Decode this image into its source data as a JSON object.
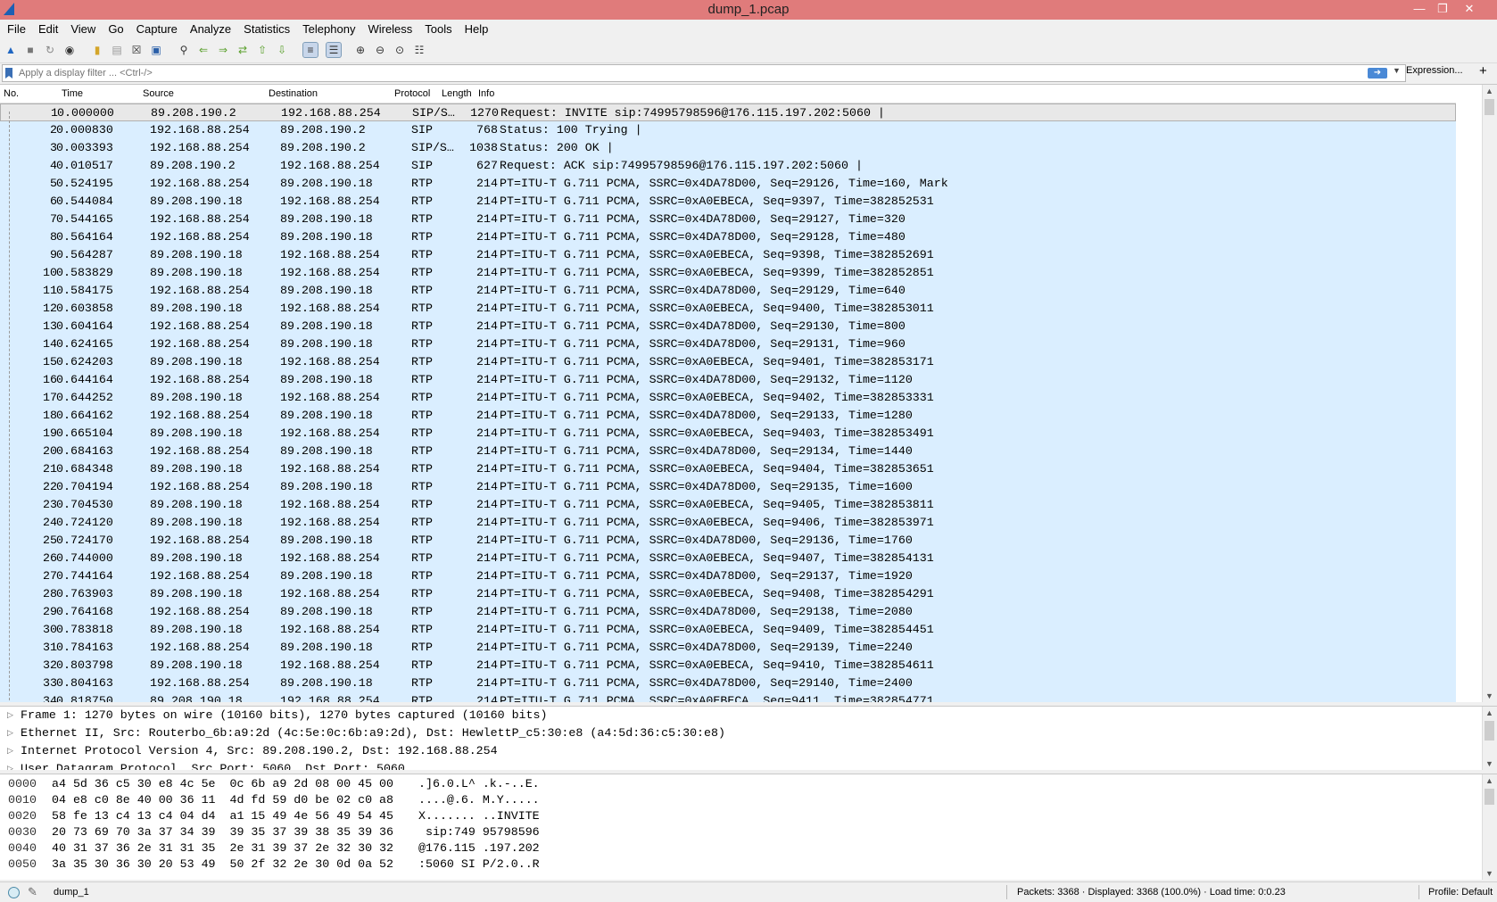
{
  "window": {
    "title": "dump_1.pcap"
  },
  "menu": [
    "File",
    "Edit",
    "View",
    "Go",
    "Capture",
    "Analyze",
    "Statistics",
    "Telephony",
    "Wireless",
    "Tools",
    "Help"
  ],
  "filter": {
    "placeholder": "Apply a display filter ... <Ctrl-/>",
    "expression_label": "Expression...",
    "add_label": "+"
  },
  "columns": {
    "no": "No.",
    "time": "Time",
    "source": "Source",
    "destination": "Destination",
    "protocol": "Protocol",
    "length": "Length",
    "info": "Info"
  },
  "packets": [
    [
      "1",
      "0.000000",
      "89.208.190.2",
      "192.168.88.254",
      "SIP/S…",
      "1270",
      "Request: INVITE sip:74995798596@176.115.197.202:5060 |"
    ],
    [
      "2",
      "0.000830",
      "192.168.88.254",
      "89.208.190.2",
      "SIP",
      "768",
      "Status: 100 Trying |"
    ],
    [
      "3",
      "0.003393",
      "192.168.88.254",
      "89.208.190.2",
      "SIP/S…",
      "1038",
      "Status: 200 OK |"
    ],
    [
      "4",
      "0.010517",
      "89.208.190.2",
      "192.168.88.254",
      "SIP",
      "627",
      "Request: ACK sip:74995798596@176.115.197.202:5060 |"
    ],
    [
      "5",
      "0.524195",
      "192.168.88.254",
      "89.208.190.18",
      "RTP",
      "214",
      "PT=ITU-T G.711 PCMA, SSRC=0x4DA78D00, Seq=29126, Time=160, Mark"
    ],
    [
      "6",
      "0.544084",
      "89.208.190.18",
      "192.168.88.254",
      "RTP",
      "214",
      "PT=ITU-T G.711 PCMA, SSRC=0xA0EBECA, Seq=9397, Time=382852531"
    ],
    [
      "7",
      "0.544165",
      "192.168.88.254",
      "89.208.190.18",
      "RTP",
      "214",
      "PT=ITU-T G.711 PCMA, SSRC=0x4DA78D00, Seq=29127, Time=320"
    ],
    [
      "8",
      "0.564164",
      "192.168.88.254",
      "89.208.190.18",
      "RTP",
      "214",
      "PT=ITU-T G.711 PCMA, SSRC=0x4DA78D00, Seq=29128, Time=480"
    ],
    [
      "9",
      "0.564287",
      "89.208.190.18",
      "192.168.88.254",
      "RTP",
      "214",
      "PT=ITU-T G.711 PCMA, SSRC=0xA0EBECA, Seq=9398, Time=382852691"
    ],
    [
      "10",
      "0.583829",
      "89.208.190.18",
      "192.168.88.254",
      "RTP",
      "214",
      "PT=ITU-T G.711 PCMA, SSRC=0xA0EBECA, Seq=9399, Time=382852851"
    ],
    [
      "11",
      "0.584175",
      "192.168.88.254",
      "89.208.190.18",
      "RTP",
      "214",
      "PT=ITU-T G.711 PCMA, SSRC=0x4DA78D00, Seq=29129, Time=640"
    ],
    [
      "12",
      "0.603858",
      "89.208.190.18",
      "192.168.88.254",
      "RTP",
      "214",
      "PT=ITU-T G.711 PCMA, SSRC=0xA0EBECA, Seq=9400, Time=382853011"
    ],
    [
      "13",
      "0.604164",
      "192.168.88.254",
      "89.208.190.18",
      "RTP",
      "214",
      "PT=ITU-T G.711 PCMA, SSRC=0x4DA78D00, Seq=29130, Time=800"
    ],
    [
      "14",
      "0.624165",
      "192.168.88.254",
      "89.208.190.18",
      "RTP",
      "214",
      "PT=ITU-T G.711 PCMA, SSRC=0x4DA78D00, Seq=29131, Time=960"
    ],
    [
      "15",
      "0.624203",
      "89.208.190.18",
      "192.168.88.254",
      "RTP",
      "214",
      "PT=ITU-T G.711 PCMA, SSRC=0xA0EBECA, Seq=9401, Time=382853171"
    ],
    [
      "16",
      "0.644164",
      "192.168.88.254",
      "89.208.190.18",
      "RTP",
      "214",
      "PT=ITU-T G.711 PCMA, SSRC=0x4DA78D00, Seq=29132, Time=1120"
    ],
    [
      "17",
      "0.644252",
      "89.208.190.18",
      "192.168.88.254",
      "RTP",
      "214",
      "PT=ITU-T G.711 PCMA, SSRC=0xA0EBECA, Seq=9402, Time=382853331"
    ],
    [
      "18",
      "0.664162",
      "192.168.88.254",
      "89.208.190.18",
      "RTP",
      "214",
      "PT=ITU-T G.711 PCMA, SSRC=0x4DA78D00, Seq=29133, Time=1280"
    ],
    [
      "19",
      "0.665104",
      "89.208.190.18",
      "192.168.88.254",
      "RTP",
      "214",
      "PT=ITU-T G.711 PCMA, SSRC=0xA0EBECA, Seq=9403, Time=382853491"
    ],
    [
      "20",
      "0.684163",
      "192.168.88.254",
      "89.208.190.18",
      "RTP",
      "214",
      "PT=ITU-T G.711 PCMA, SSRC=0x4DA78D00, Seq=29134, Time=1440"
    ],
    [
      "21",
      "0.684348",
      "89.208.190.18",
      "192.168.88.254",
      "RTP",
      "214",
      "PT=ITU-T G.711 PCMA, SSRC=0xA0EBECA, Seq=9404, Time=382853651"
    ],
    [
      "22",
      "0.704194",
      "192.168.88.254",
      "89.208.190.18",
      "RTP",
      "214",
      "PT=ITU-T G.711 PCMA, SSRC=0x4DA78D00, Seq=29135, Time=1600"
    ],
    [
      "23",
      "0.704530",
      "89.208.190.18",
      "192.168.88.254",
      "RTP",
      "214",
      "PT=ITU-T G.711 PCMA, SSRC=0xA0EBECA, Seq=9405, Time=382853811"
    ],
    [
      "24",
      "0.724120",
      "89.208.190.18",
      "192.168.88.254",
      "RTP",
      "214",
      "PT=ITU-T G.711 PCMA, SSRC=0xA0EBECA, Seq=9406, Time=382853971"
    ],
    [
      "25",
      "0.724170",
      "192.168.88.254",
      "89.208.190.18",
      "RTP",
      "214",
      "PT=ITU-T G.711 PCMA, SSRC=0x4DA78D00, Seq=29136, Time=1760"
    ],
    [
      "26",
      "0.744000",
      "89.208.190.18",
      "192.168.88.254",
      "RTP",
      "214",
      "PT=ITU-T G.711 PCMA, SSRC=0xA0EBECA, Seq=9407, Time=382854131"
    ],
    [
      "27",
      "0.744164",
      "192.168.88.254",
      "89.208.190.18",
      "RTP",
      "214",
      "PT=ITU-T G.711 PCMA, SSRC=0x4DA78D00, Seq=29137, Time=1920"
    ],
    [
      "28",
      "0.763903",
      "89.208.190.18",
      "192.168.88.254",
      "RTP",
      "214",
      "PT=ITU-T G.711 PCMA, SSRC=0xA0EBECA, Seq=9408, Time=382854291"
    ],
    [
      "29",
      "0.764168",
      "192.168.88.254",
      "89.208.190.18",
      "RTP",
      "214",
      "PT=ITU-T G.711 PCMA, SSRC=0x4DA78D00, Seq=29138, Time=2080"
    ],
    [
      "30",
      "0.783818",
      "89.208.190.18",
      "192.168.88.254",
      "RTP",
      "214",
      "PT=ITU-T G.711 PCMA, SSRC=0xA0EBECA, Seq=9409, Time=382854451"
    ],
    [
      "31",
      "0.784163",
      "192.168.88.254",
      "89.208.190.18",
      "RTP",
      "214",
      "PT=ITU-T G.711 PCMA, SSRC=0x4DA78D00, Seq=29139, Time=2240"
    ],
    [
      "32",
      "0.803798",
      "89.208.190.18",
      "192.168.88.254",
      "RTP",
      "214",
      "PT=ITU-T G.711 PCMA, SSRC=0xA0EBECA, Seq=9410, Time=382854611"
    ],
    [
      "33",
      "0.804163",
      "192.168.88.254",
      "89.208.190.18",
      "RTP",
      "214",
      "PT=ITU-T G.711 PCMA, SSRC=0x4DA78D00, Seq=29140, Time=2400"
    ],
    [
      "34",
      "0.818750",
      "89.208.190.18",
      "192.168.88.254",
      "RTP",
      "214",
      "PT=ITU-T G.711 PCMA, SSRC=0xA0EBECA, Seq=9411, Time=382854771"
    ]
  ],
  "details": [
    "Frame 1: 1270 bytes on wire (10160 bits), 1270 bytes captured (10160 bits)",
    "Ethernet II, Src: Routerbo_6b:a9:2d (4c:5e:0c:6b:a9:2d), Dst: HewlettP_c5:30:e8 (a4:5d:36:c5:30:e8)",
    "Internet Protocol Version 4, Src: 89.208.190.2, Dst: 192.168.88.254",
    "User Datagram Protocol, Src Port: 5060, Dst Port: 5060"
  ],
  "bytes": [
    [
      "0000",
      "a4 5d 36 c5 30 e8 4c 5e  0c 6b a9 2d 08 00 45 00",
      ".]6.0.L^ .k.-..E."
    ],
    [
      "0010",
      "04 e8 c0 8e 40 00 36 11  4d fd 59 d0 be 02 c0 a8",
      "....@.6. M.Y....."
    ],
    [
      "0020",
      "58 fe 13 c4 13 c4 04 d4  a1 15 49 4e 56 49 54 45",
      "X....... ..INVITE"
    ],
    [
      "0030",
      "20 73 69 70 3a 37 34 39  39 35 37 39 38 35 39 36",
      " sip:749 95798596"
    ],
    [
      "0040",
      "40 31 37 36 2e 31 31 35  2e 31 39 37 2e 32 30 32",
      "@176.115 .197.202"
    ],
    [
      "0050",
      "3a 35 30 36 30 20 53 49  50 2f 32 2e 30 0d 0a 52",
      ":5060 SI P/2.0..R"
    ]
  ],
  "status": {
    "file": "dump_1",
    "stats": "Packets: 3368 · Displayed: 3368 (100.0%) · Load time: 0:0.23",
    "profile": "Profile: Default"
  },
  "colors": {
    "titlebar": "#e07b7b",
    "row_bg": "#daeeff",
    "selected_row": "#e8e8e8"
  }
}
